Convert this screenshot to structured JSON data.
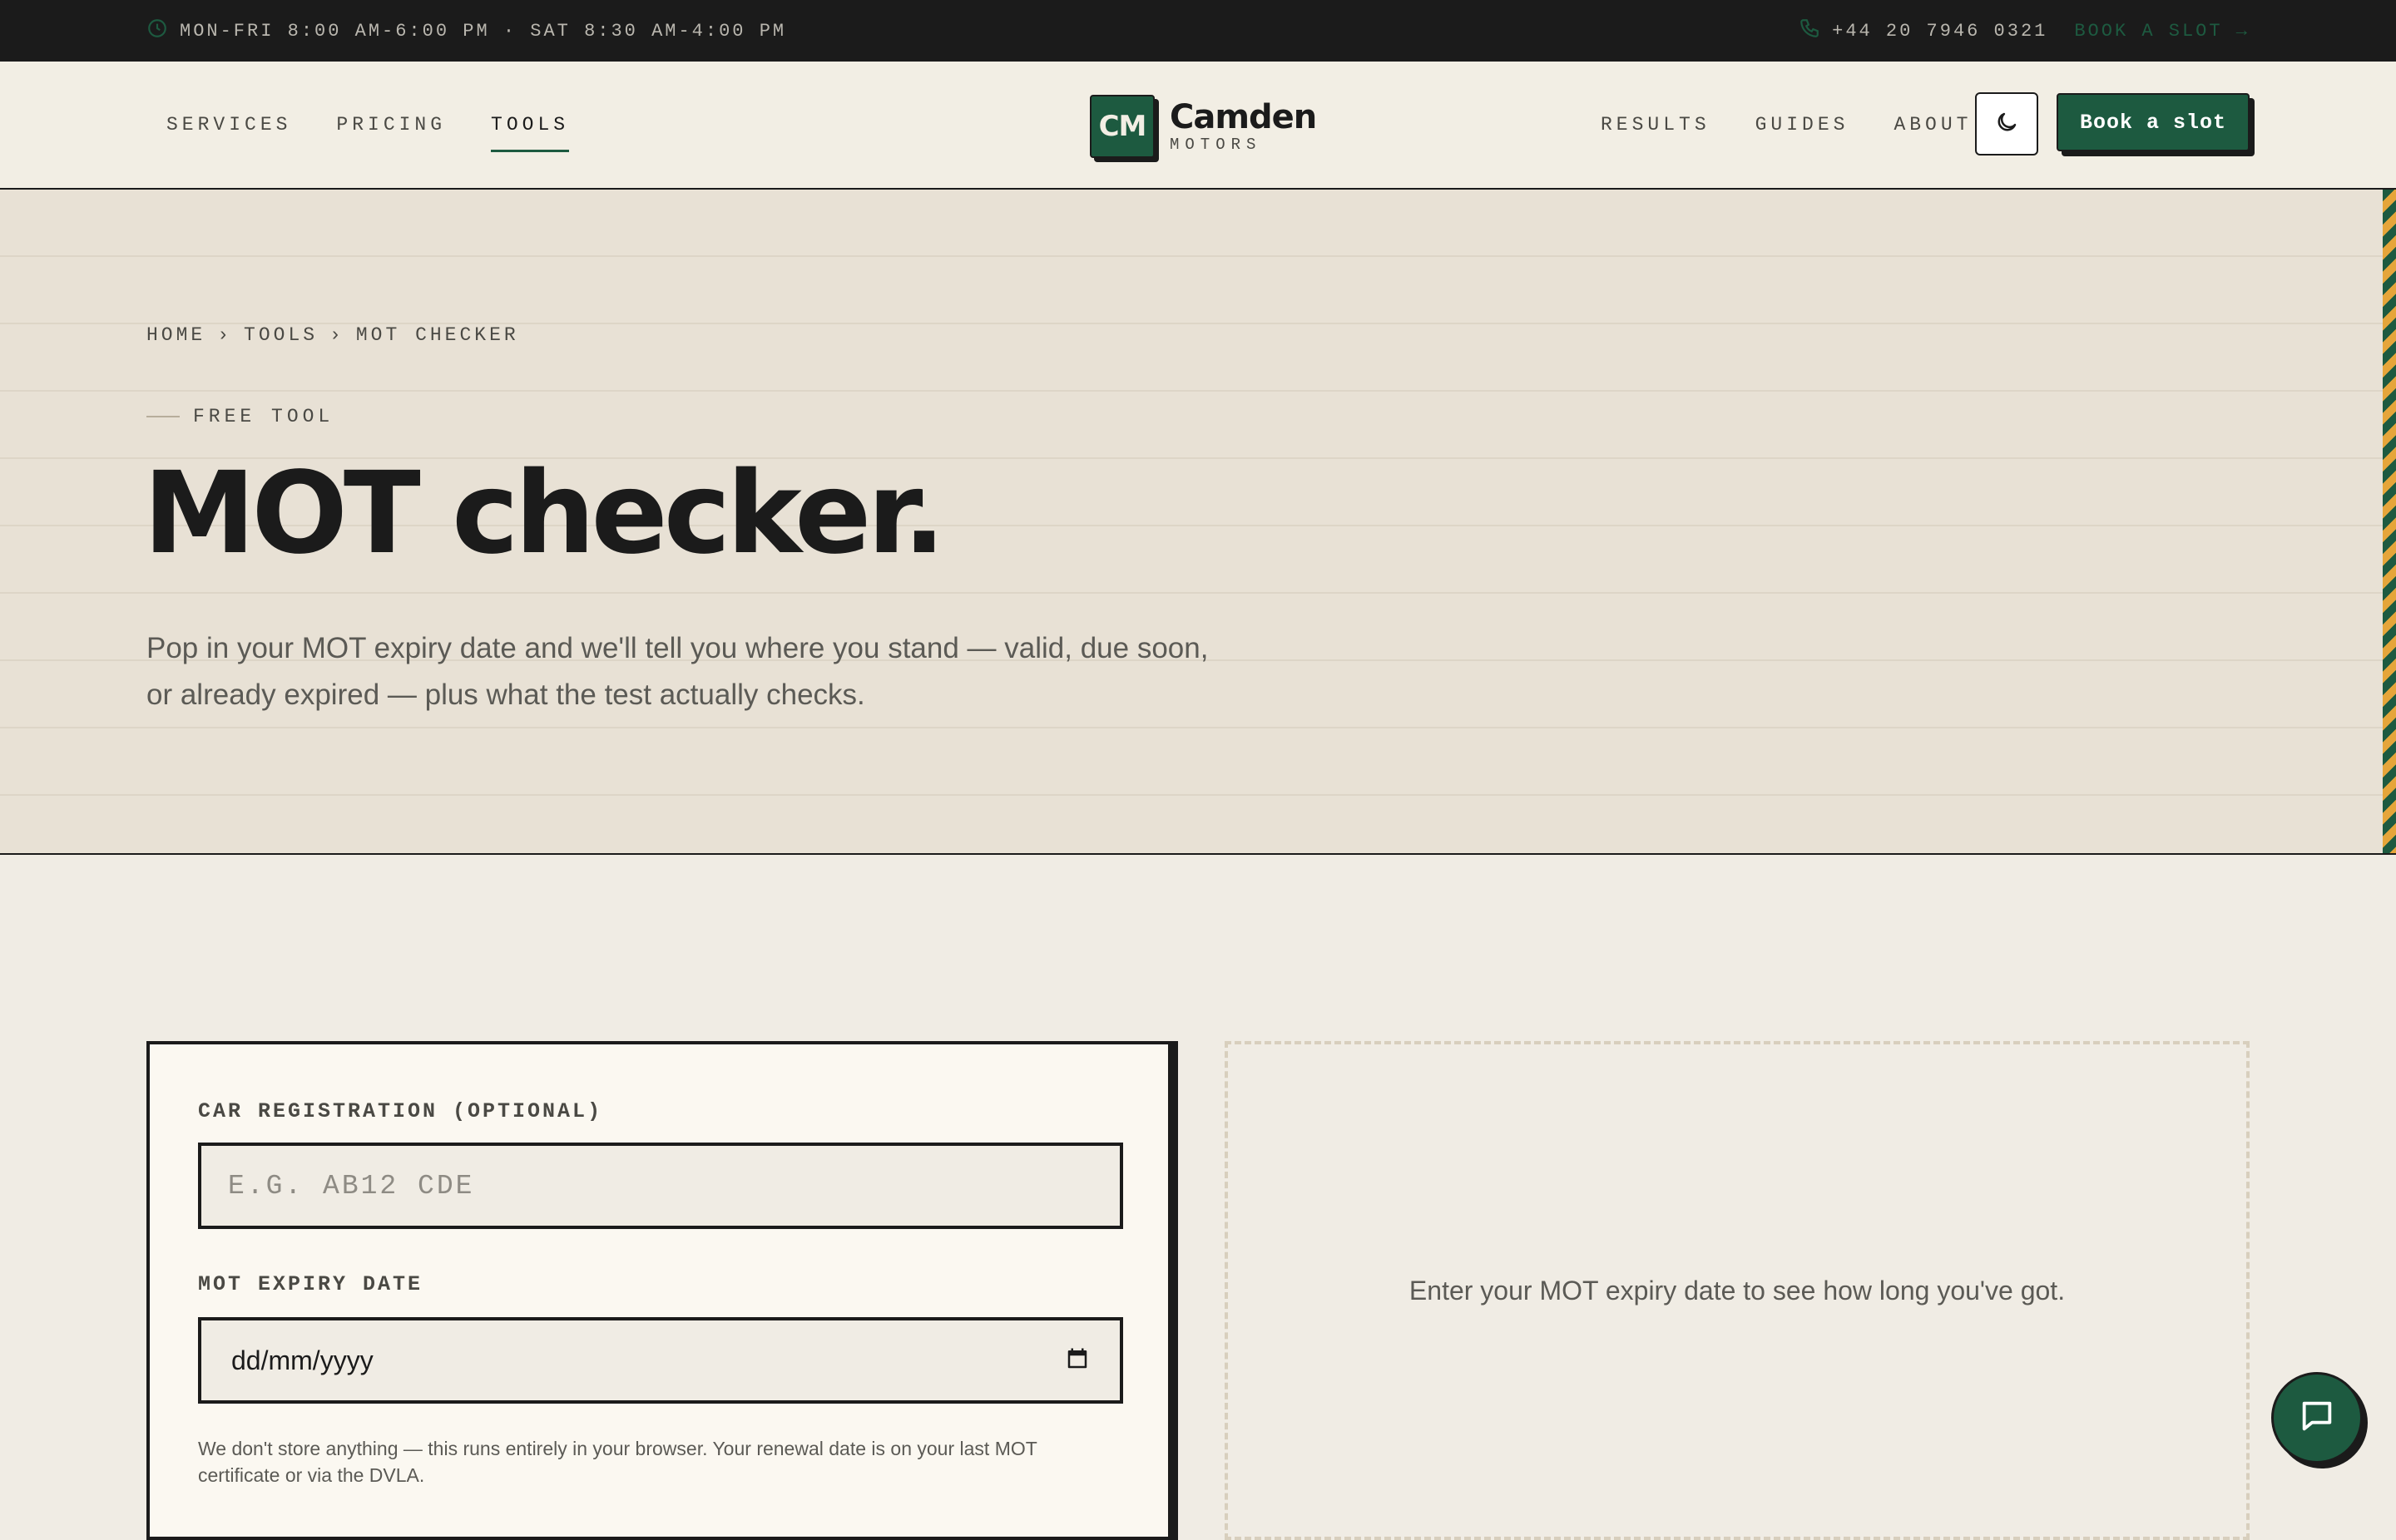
{
  "topbar": {
    "hours": "MON-FRI 8:00 AM-6:00 PM · SAT 8:30 AM-4:00 PM",
    "phone": "+44 20 7946 0321",
    "book_link": "BOOK A SLOT",
    "book_arrow": "→",
    "clock_icon": "clock-icon",
    "phone_icon": "phone-icon"
  },
  "nav": {
    "left": [
      "SERVICES",
      "PRICING",
      "TOOLS"
    ],
    "active": "TOOLS",
    "right": [
      "RESULTS",
      "GUIDES",
      "ABOUT"
    ]
  },
  "logo": {
    "mark": "CM",
    "name": "Camden",
    "sub": "MOTORS"
  },
  "header": {
    "theme_icon": "moon-icon",
    "cta": "Book a slot"
  },
  "hero": {
    "breadcrumb": [
      "HOME",
      "TOOLS",
      "MOT CHECKER"
    ],
    "breadcrumb_sep": "›",
    "eyebrow": "FREE TOOL",
    "title": "MOT checker.",
    "description_line1": "Pop in your MOT expiry date and we'll tell you where you stand — valid, due soon,",
    "description_line2": "or already expired — plus what the test actually checks."
  },
  "form": {
    "reg_label": "CAR REGISTRATION (OPTIONAL)",
    "reg_placeholder": "E.G. AB12 CDE",
    "date_label": "MOT EXPIRY DATE",
    "date_value": "dd/mm/yyyy",
    "help_line1": "We don't store anything — this runs entirely in your browser. Your renewal date is on your last MOT",
    "help_line2": "certificate or via the DVLA."
  },
  "result": {
    "message": "Enter your MOT expiry date to see how long you've got."
  },
  "chat": {
    "icon": "chat-icon"
  },
  "colors": {
    "brand_green": "#1d5a40",
    "accent_amber": "#e5a53a",
    "ink": "#1b1b1b",
    "paper": "#f0ece4"
  }
}
